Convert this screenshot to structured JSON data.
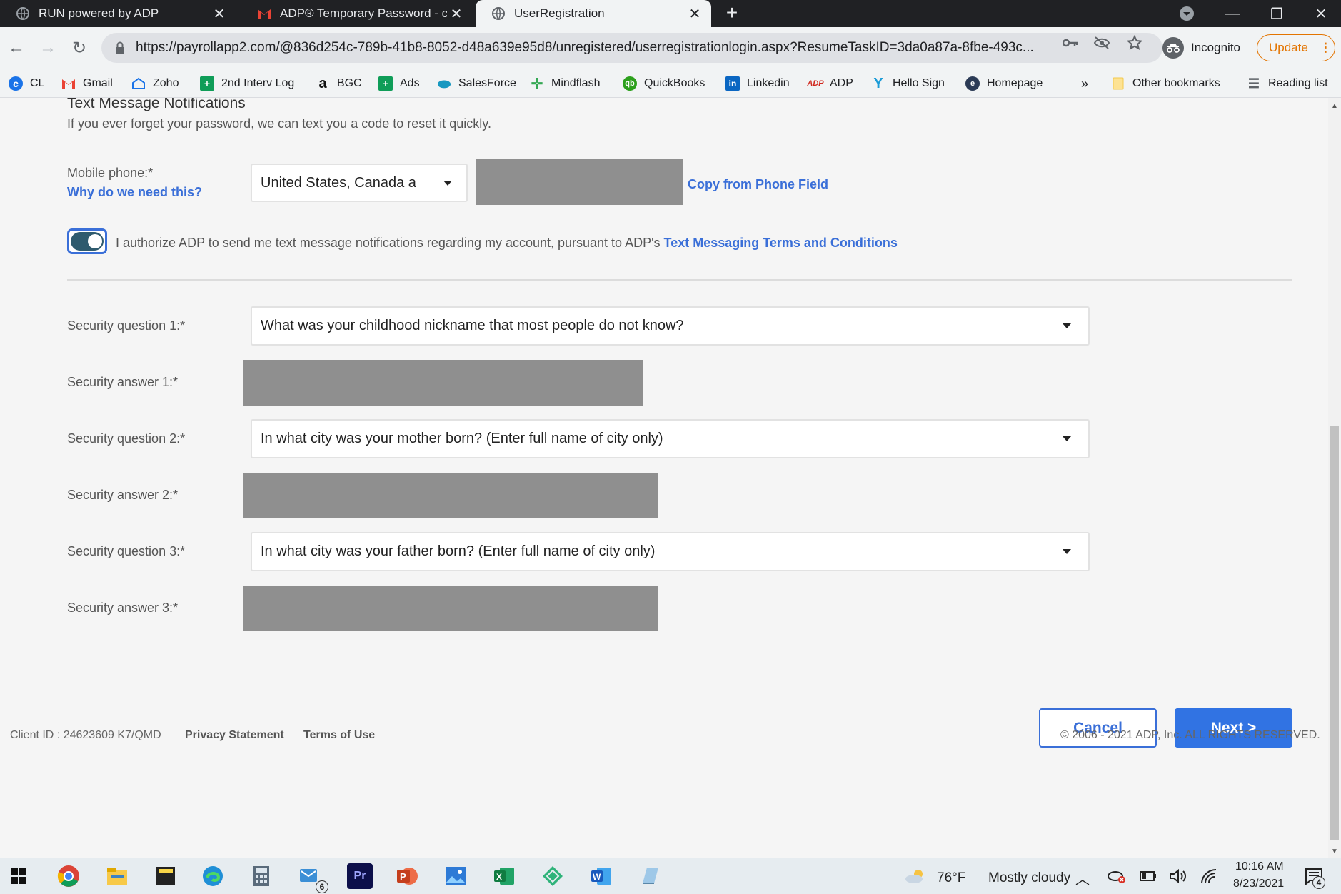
{
  "browser": {
    "tabs": [
      {
        "title": "RUN powered by ADP",
        "active": false
      },
      {
        "title": "ADP® Temporary Password - clw",
        "active": false
      },
      {
        "title": "UserRegistration",
        "active": true
      }
    ],
    "url": "https://payrollapp2.com/@836d254c-789b-41b8-8052-d48a639e95d8/unregistered/userregistrationlogin.aspx?ResumeTaskID=3da0a87a-8fbe-493c...",
    "incognito_label": "Incognito",
    "update_label": "Update",
    "bookmarks": [
      {
        "label": "CL",
        "icon": "cl-icon"
      },
      {
        "label": "Gmail",
        "icon": "gmail-icon"
      },
      {
        "label": "Zoho",
        "icon": "zoho-icon"
      },
      {
        "label": "2nd Interv Log",
        "icon": "sheets-icon"
      },
      {
        "label": "BGC",
        "icon": "amazon-icon"
      },
      {
        "label": "Ads",
        "icon": "sheets-icon"
      },
      {
        "label": "SalesForce",
        "icon": "salesforce-icon"
      },
      {
        "label": "Mindflash",
        "icon": "mindflash-icon"
      },
      {
        "label": "QuickBooks",
        "icon": "quickbooks-icon"
      },
      {
        "label": "Linkedin",
        "icon": "linkedin-icon"
      },
      {
        "label": "ADP",
        "icon": "adp-icon"
      },
      {
        "label": "Hello Sign",
        "icon": "hellosign-icon"
      },
      {
        "label": "Homepage",
        "icon": "homepage-icon"
      }
    ],
    "overflow_label": "»",
    "other_bookmarks": "Other bookmarks",
    "reading_list": "Reading list"
  },
  "page": {
    "section_title": "Text Message Notifications",
    "section_desc": "If you ever forget your password, we can text you a code to reset it quickly.",
    "mobile_label": "Mobile phone:*",
    "why_link": "Why do we need this?",
    "country_value": "United States, Canada a",
    "copy_link": "Copy from Phone Field",
    "auth_text": "I authorize ADP to send me text message notifications regarding my account, pursuant to ADP's",
    "auth_link": "Text Messaging Terms and Conditions",
    "toggle_on": true,
    "questions": [
      {
        "q_label": "Security question 1:*",
        "q_value": "What was your childhood nickname that most people do not know?",
        "a_label": "Security answer 1:*"
      },
      {
        "q_label": "Security question 2:*",
        "q_value": "In what city was your mother born? (Enter full name of city only)",
        "a_label": "Security answer 2:*"
      },
      {
        "q_label": "Security question 3:*",
        "q_value": "In what city was your father born? (Enter full name of city only)",
        "a_label": "Security answer 3:*"
      }
    ],
    "cancel_label": "Cancel",
    "next_label": "Next >"
  },
  "footer": {
    "client_id": "Client ID : 24623609 K7/QMD",
    "privacy": "Privacy Statement",
    "terms": "Terms of Use",
    "copyright": "© 2006 - 2021 ADP, Inc. ALL RIGHTS RESERVED."
  },
  "taskbar": {
    "weather_temp": "76°F",
    "weather_desc": "Mostly cloudy",
    "time": "10:16 AM",
    "date": "8/23/2021",
    "mail_badge": "6",
    "notif_badge": "4"
  },
  "colors": {
    "link": "#3a6fd8",
    "primary_button": "#3173e3",
    "toggle_track": "#2f5b6e",
    "redacted": "#8f8f8f"
  }
}
